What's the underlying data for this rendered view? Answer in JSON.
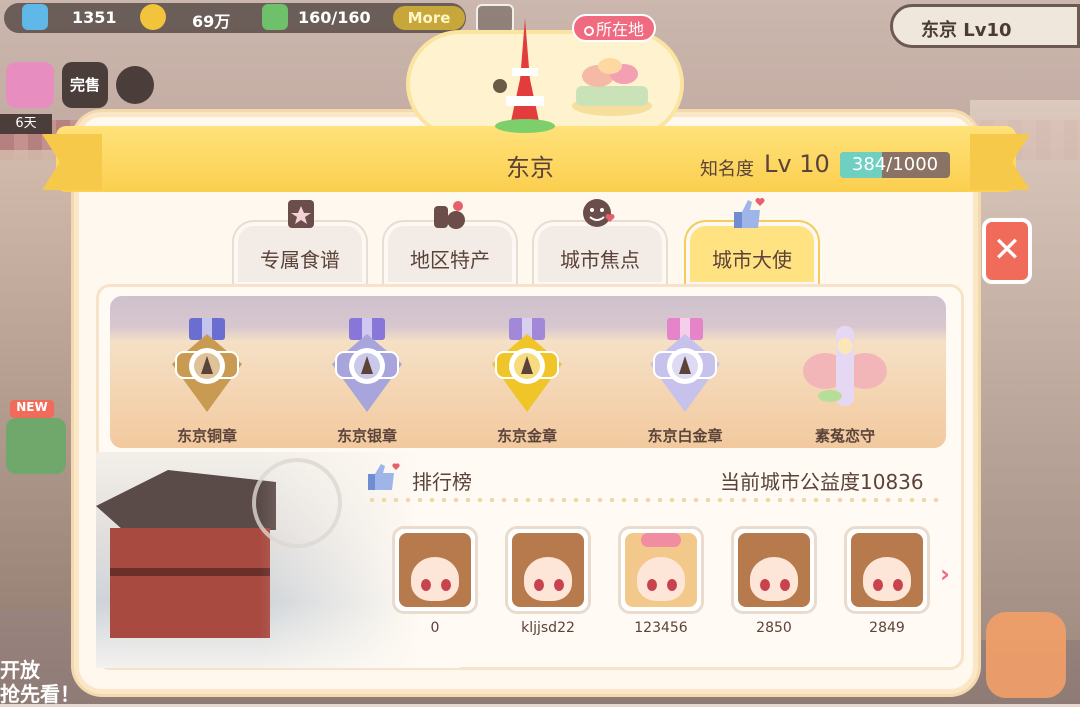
{
  "hud": {
    "gems": "1351",
    "coins": "69万",
    "energy": "160/160",
    "more_label": "More",
    "level": "东京 Lv10"
  },
  "side": {
    "event_days": "6天",
    "sale_label": "完售",
    "new_label": "NEW",
    "bottom_line1": "开放",
    "bottom_line2": "抢先看！"
  },
  "location_tag": "所在地",
  "dialog": {
    "title": "东京",
    "fame_label": "知名度",
    "fame_level": "Lv 10",
    "fame_progress_text": "384/1000",
    "fame_progress": 0.384
  },
  "tabs": [
    {
      "label": "专属食谱",
      "active": false
    },
    {
      "label": "地区特产",
      "active": false
    },
    {
      "label": "城市焦点",
      "active": false
    },
    {
      "label": "城市大使",
      "active": true
    }
  ],
  "medals": [
    {
      "name": "东京铜章",
      "color": "#c99a52",
      "ribbon": "#6a6ed1"
    },
    {
      "name": "东京银章",
      "color": "#a7a5dc",
      "ribbon": "#8877d8"
    },
    {
      "name": "东京金章",
      "color": "#f0c52a",
      "ribbon": "#a188d8"
    },
    {
      "name": "东京白金章",
      "color": "#c6c2ec",
      "ribbon": "#e584c8"
    },
    {
      "name": "素菟恋守",
      "color": "#f3b6b8",
      "ribbon": "#e6d7f3"
    }
  ],
  "ranking": {
    "title": "排行榜",
    "score_text": "当前城市公益度10836",
    "entries": [
      {
        "name": "0",
        "style": "brown"
      },
      {
        "name": "kljjsd22",
        "style": "brown"
      },
      {
        "name": "123456",
        "style": "blonde"
      },
      {
        "name": "2850",
        "style": "brown"
      },
      {
        "name": "2849",
        "style": "brown"
      }
    ]
  }
}
